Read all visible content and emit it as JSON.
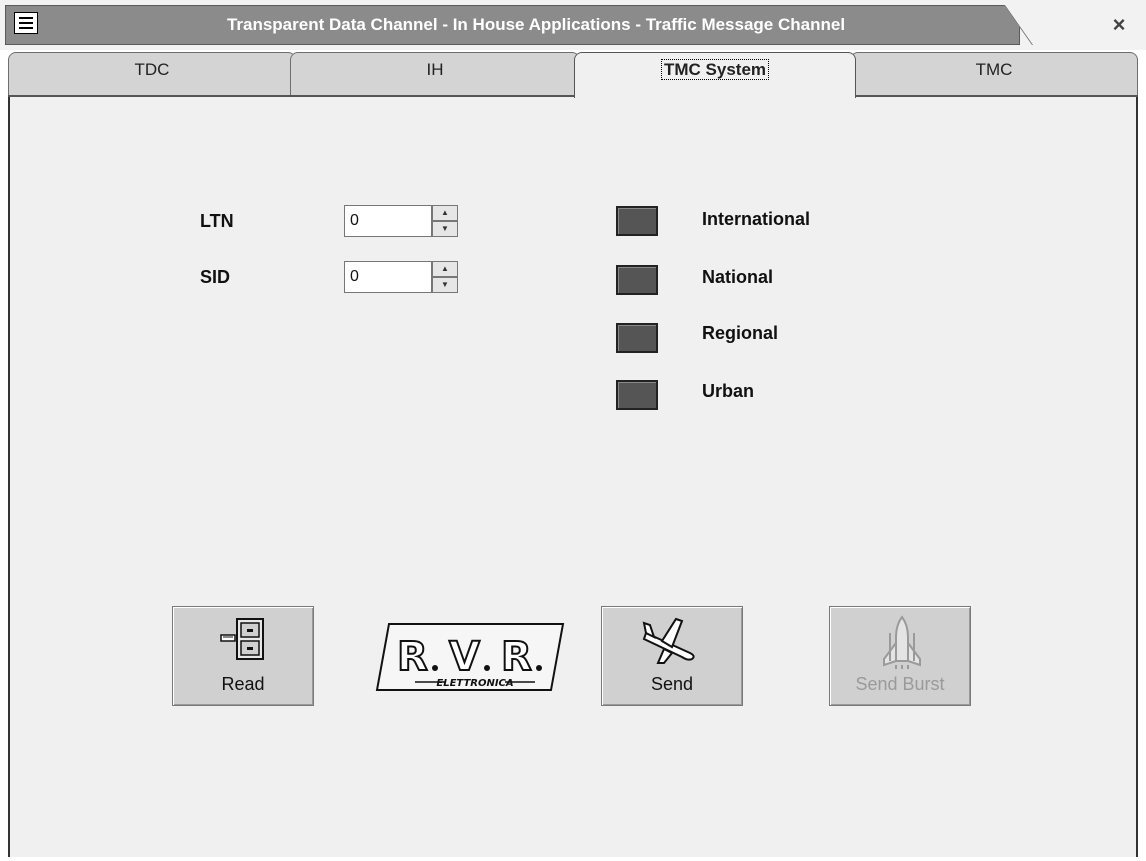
{
  "window": {
    "title": "Transparent Data Channel - In House Applications - Traffic Message Channel",
    "close_glyph": "×"
  },
  "tabs": [
    {
      "label": "TDC",
      "active": false
    },
    {
      "label": "IH",
      "active": false
    },
    {
      "label": "TMC System",
      "active": true
    },
    {
      "label": "TMC",
      "active": false
    }
  ],
  "fields": {
    "ltn": {
      "label": "LTN",
      "value": "0"
    },
    "sid": {
      "label": "SID",
      "value": "0"
    }
  },
  "indicators": [
    {
      "label": "International"
    },
    {
      "label": "National"
    },
    {
      "label": "Regional"
    },
    {
      "label": "Urban"
    }
  ],
  "buttons": {
    "read": {
      "label": "Read",
      "icon": "file-cabinet-icon",
      "enabled": true
    },
    "send": {
      "label": "Send",
      "icon": "airplane-icon",
      "enabled": true
    },
    "send_burst": {
      "label": "Send Burst",
      "icon": "space-shuttle-icon",
      "enabled": false
    }
  },
  "logo": {
    "brand": "R.V.R.",
    "subtitle": "ELETTRONICA"
  },
  "colors": {
    "titlebar": "#8b8b8b",
    "panel": "#f0f0f0",
    "led_off": "#555555"
  }
}
